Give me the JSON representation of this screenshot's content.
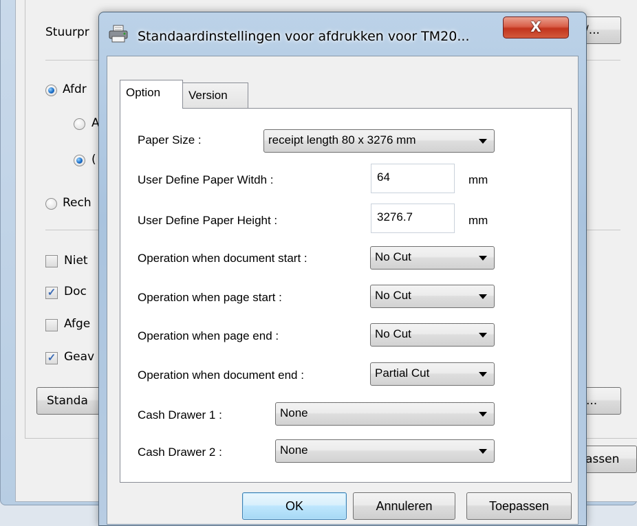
{
  "background_window": {
    "driver_label": "Stuurpr",
    "radio_print": "Afdr",
    "radio_sub_a": "A",
    "radio_sub_b": "(",
    "radio_rech": "Rech",
    "check_niet": "Niet",
    "check_doc": "Doc",
    "check_afge": "Afge",
    "check_geav": "Geav",
    "button_standa": "Standa",
    "button_top_partial": "/...",
    "button_mid_partial": "...",
    "button_bottom_partial": "assen"
  },
  "dialog": {
    "title": "Standaardinstellingen voor afdrukken voor TM20...",
    "close_label": "X",
    "tabs": [
      {
        "label": "Option",
        "active": true
      },
      {
        "label": "Version",
        "active": false
      }
    ],
    "fields": {
      "paper_size": {
        "label": "Paper Size :",
        "value": "receipt length 80 x 3276 mm"
      },
      "user_width": {
        "label": "User Define Paper Witdh :",
        "value": "64",
        "unit": "mm"
      },
      "user_height": {
        "label": "User Define Paper Height :",
        "value": "3276.7",
        "unit": "mm"
      },
      "doc_start": {
        "label": "Operation when document start :",
        "value": "No Cut"
      },
      "page_start": {
        "label": "Operation when page start :",
        "value": "No Cut"
      },
      "page_end": {
        "label": "Operation when page end :",
        "value": "No Cut"
      },
      "doc_end": {
        "label": "Operation when document end :",
        "value": "Partial Cut"
      },
      "cash_drawer_1": {
        "label": "Cash Drawer 1 :",
        "value": "None"
      },
      "cash_drawer_2": {
        "label": "Cash Drawer 2 :",
        "value": "None"
      }
    },
    "buttons": {
      "ok": "OK",
      "cancel": "Annuleren",
      "apply": "Toepassen"
    }
  },
  "icons": {
    "printer": "printer-icon",
    "close": "close-icon",
    "dropdown": "chevron-down-icon"
  },
  "colors": {
    "title_bar": "#b5cce4",
    "close_button": "#c8452b",
    "default_button": "#bee6fd"
  }
}
